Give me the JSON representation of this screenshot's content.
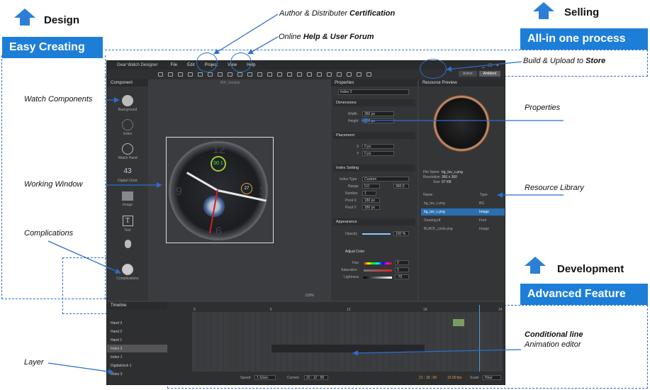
{
  "sections": {
    "design": {
      "title": "Design",
      "banner": "Easy Creating"
    },
    "selling": {
      "title": "Selling",
      "banner": "All-in one process"
    },
    "development": {
      "title": "Development",
      "banner": "Advanced Feature"
    }
  },
  "annotations": {
    "certification": {
      "prefix": "Author & Distributer ",
      "bold": "Certification"
    },
    "help": {
      "prefix": "Online ",
      "bold": "Help & User Forum"
    },
    "build": {
      "prefix": "Build & Upload to ",
      "bold": "Store"
    },
    "watch_components": "Watch Components",
    "working_window": "Working Window",
    "complications": "Complications",
    "layer": "Layer",
    "properties": "Properties",
    "resource_library": "Resource Library",
    "conditional_line": "Conditional line",
    "animation_editor": "Animation editor"
  },
  "app": {
    "title": "Gear Watch Designer",
    "menu": [
      "File",
      "Edit",
      "Project",
      "View",
      "Help"
    ],
    "tabs": [
      "Active",
      "Ambient"
    ],
    "component_panel": {
      "title": "Component",
      "items": [
        "Background",
        "Index",
        "Watch Hand",
        "Digital Clock",
        "Image",
        "Text",
        "",
        "Complications"
      ]
    },
    "canvas_title": "BW_Sample",
    "zoom": "100%",
    "watch": {
      "digital": "00 1",
      "date": "27",
      "numbers": [
        "12",
        "3",
        "6",
        "9"
      ]
    },
    "properties": {
      "title": "Properties",
      "selected": "Index 2",
      "sections": [
        "Dimensions",
        "Placement",
        "Index Setting",
        "Appearance"
      ],
      "dimensions": {
        "width_label": "Width",
        "width": "360 px",
        "height_label": "Height",
        "height": "360 px"
      },
      "placement": {
        "x_label": "X",
        "x": "0 px",
        "y_label": "Y",
        "y": "0 px"
      },
      "index": {
        "type_label": "Index Type",
        "type": "Custom",
        "range_label": "Range",
        "range_from": "0.0",
        "range_to": "360.0",
        "number_label": "Number",
        "number": "1",
        "pivot_x_label": "Pivot X",
        "pivot_x": "180 px",
        "pivot_y_label": "Pivot Y",
        "pivot_y": "180 px"
      },
      "appearance": {
        "opacity_label": "Opacity",
        "opacity": "100 %"
      },
      "adjust_color": {
        "title": "Adjust Color",
        "hue_label": "Hue",
        "hue": "0",
        "saturation_label": "Saturation",
        "saturation": "0",
        "lightness_label": "Lightness",
        "lightness": "-70"
      },
      "unit": "px"
    },
    "resource": {
      "title": "Resource Preview",
      "file_name_label": "File Name",
      "file_name": "bg_luv_c.png",
      "resolution_label": "Resolution",
      "resolution": "360 x 360",
      "size_label": "Size",
      "size": "97 KB",
      "columns": [
        "Name",
        "Type"
      ],
      "rows": [
        {
          "name": "bg_luv_c.png",
          "type": "BG"
        },
        {
          "name": "bg_luv_c.png",
          "type": "Image"
        },
        {
          "name": "Gearlog.ttf",
          "type": "Font"
        },
        {
          "name": "BLACK_circle.png",
          "type": "Image"
        }
      ]
    },
    "timeline": {
      "title": "Timeline",
      "layers": [
        "Hand 3",
        "Hand 2",
        "Hand 1",
        "Index 2",
        "Index 1",
        "Digitalclock 1",
        "Index 3"
      ],
      "ruler": [
        "0",
        "6",
        "12",
        "18",
        "24"
      ],
      "speed_label": "Speed",
      "speed": "1 S/sec",
      "current_label": "Current",
      "current": "22 : 12 : 58",
      "time": "21 : 18 : 00",
      "fps": "15.00 fps",
      "scale_label": "Scale",
      "scale": "Hour"
    }
  }
}
